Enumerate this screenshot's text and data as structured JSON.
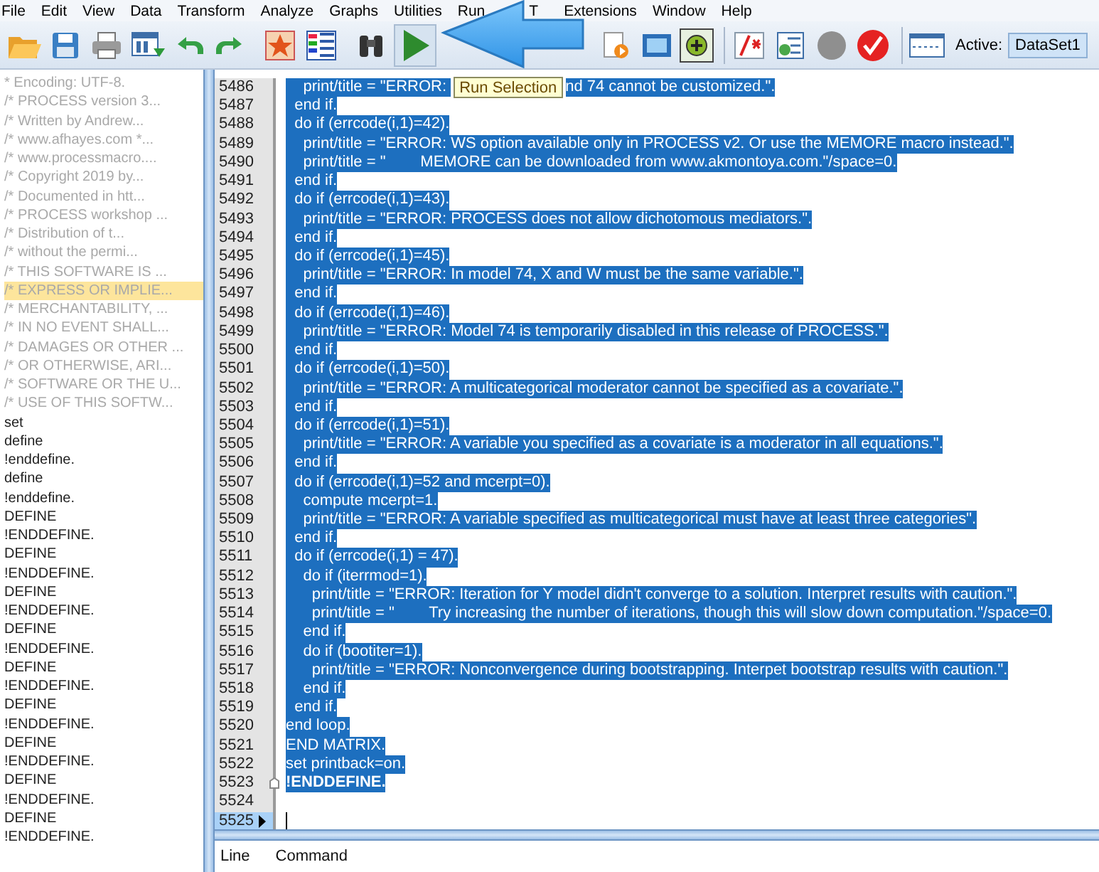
{
  "menu": [
    "File",
    "Edit",
    "View",
    "Data",
    "Transform",
    "Analyze",
    "Graphs",
    "Utilities",
    "Run",
    "T",
    "Extensions",
    "Window",
    "Help"
  ],
  "toolbar": {
    "active_label": "Active:",
    "dataset": "DataSet1"
  },
  "tooltip": "Run Selection",
  "navigator": [
    {
      "text": "* Encoding: UTF-8.",
      "kind": "comment",
      "selected": false
    },
    {
      "text": "/* PROCESS version 3...",
      "kind": "comment",
      "selected": false
    },
    {
      "text": "/* Written by Andrew...",
      "kind": "comment",
      "selected": false
    },
    {
      "text": "/* www.afhayes.com *...",
      "kind": "comment",
      "selected": false
    },
    {
      "text": "/* www.processmacro....",
      "kind": "comment",
      "selected": false
    },
    {
      "text": "/* Copyright 2019 by...",
      "kind": "comment",
      "selected": false
    },
    {
      "text": "/* Documented in htt...",
      "kind": "comment",
      "selected": false
    },
    {
      "text": "/* PROCESS workshop ...",
      "kind": "comment",
      "selected": false
    },
    {
      "text": "/* Distribution of t...",
      "kind": "comment",
      "selected": false
    },
    {
      "text": "/* without the permi...",
      "kind": "comment",
      "selected": false
    },
    {
      "text": "/* THIS SOFTWARE IS ...",
      "kind": "comment",
      "selected": false
    },
    {
      "text": "/* EXPRESS OR IMPLIE...",
      "kind": "comment",
      "selected": true
    },
    {
      "text": "/* MERCHANTABILITY, ...",
      "kind": "comment",
      "selected": false
    },
    {
      "text": "/* IN NO EVENT SHALL...",
      "kind": "comment",
      "selected": false
    },
    {
      "text": "/* DAMAGES OR OTHER ...",
      "kind": "comment",
      "selected": false
    },
    {
      "text": "/* OR OTHERWISE, ARI...",
      "kind": "comment",
      "selected": false
    },
    {
      "text": "/* SOFTWARE OR THE U...",
      "kind": "comment",
      "selected": false
    },
    {
      "text": "/* USE OF THIS SOFTW...",
      "kind": "comment",
      "selected": false
    },
    {
      "text": "set",
      "kind": "command",
      "selected": false
    },
    {
      "text": "define",
      "kind": "command",
      "selected": false
    },
    {
      "text": "!enddefine.",
      "kind": "command",
      "selected": false
    },
    {
      "text": "define",
      "kind": "command",
      "selected": false
    },
    {
      "text": "!enddefine.",
      "kind": "command",
      "selected": false
    },
    {
      "text": "DEFINE",
      "kind": "command",
      "selected": false
    },
    {
      "text": "!ENDDEFINE.",
      "kind": "command",
      "selected": false
    },
    {
      "text": "DEFINE",
      "kind": "command",
      "selected": false
    },
    {
      "text": "!ENDDEFINE.",
      "kind": "command",
      "selected": false
    },
    {
      "text": "DEFINE",
      "kind": "command",
      "selected": false
    },
    {
      "text": "!ENDDEFINE.",
      "kind": "command",
      "selected": false
    },
    {
      "text": "DEFINE",
      "kind": "command",
      "selected": false
    },
    {
      "text": "!ENDDEFINE.",
      "kind": "command",
      "selected": false
    },
    {
      "text": "DEFINE",
      "kind": "command",
      "selected": false
    },
    {
      "text": "!ENDDEFINE.",
      "kind": "command",
      "selected": false
    },
    {
      "text": "DEFINE",
      "kind": "command",
      "selected": false
    },
    {
      "text": "!ENDDEFINE.",
      "kind": "command",
      "selected": false
    },
    {
      "text": "DEFINE",
      "kind": "command",
      "selected": false
    },
    {
      "text": "!ENDDEFINE.",
      "kind": "command",
      "selected": false
    },
    {
      "text": "DEFINE",
      "kind": "command",
      "selected": false
    },
    {
      "text": "!ENDDEFINE.",
      "kind": "command",
      "selected": false
    },
    {
      "text": "DEFINE",
      "kind": "command",
      "selected": false
    },
    {
      "text": "!ENDDEFINE.",
      "kind": "command",
      "selected": false
    }
  ],
  "editor": {
    "lines": [
      {
        "number": "5486",
        "text": "    print/title = \"ERROR: ",
        "text_after": "nd 74 cannot be customized.\".",
        "selected": true,
        "current": false
      },
      {
        "number": "5487",
        "text": "  end if.",
        "selected": true,
        "current": false
      },
      {
        "number": "5488",
        "text": "  do if (errcode(i,1)=42).",
        "selected": true,
        "current": false
      },
      {
        "number": "5489",
        "text": "    print/title = \"ERROR: WS option available only in PROCESS v2. Or use the MEMORE macro instead.\".",
        "selected": true,
        "current": false
      },
      {
        "number": "5490",
        "text": "    print/title = \"        MEMORE can be downloaded from www.akmontoya.com.\"/space=0.",
        "selected": true,
        "current": false
      },
      {
        "number": "5491",
        "text": "  end if.",
        "selected": true,
        "current": false
      },
      {
        "number": "5492",
        "text": "  do if (errcode(i,1)=43).",
        "selected": true,
        "current": false
      },
      {
        "number": "5493",
        "text": "    print/title = \"ERROR: PROCESS does not allow dichotomous mediators.\".",
        "selected": true,
        "current": false
      },
      {
        "number": "5494",
        "text": "  end if.",
        "selected": true,
        "current": false
      },
      {
        "number": "5495",
        "text": "  do if (errcode(i,1)=45).",
        "selected": true,
        "current": false
      },
      {
        "number": "5496",
        "text": "    print/title = \"ERROR: In model 74, X and W must be the same variable.\".",
        "selected": true,
        "current": false
      },
      {
        "number": "5497",
        "text": "  end if.",
        "selected": true,
        "current": false
      },
      {
        "number": "5498",
        "text": "  do if (errcode(i,1)=46).",
        "selected": true,
        "current": false
      },
      {
        "number": "5499",
        "text": "    print/title = \"ERROR: Model 74 is temporarily disabled in this release of PROCESS.\".",
        "selected": true,
        "current": false
      },
      {
        "number": "5500",
        "text": "  end if.",
        "selected": true,
        "current": false
      },
      {
        "number": "5501",
        "text": "  do if (errcode(i,1)=50).",
        "selected": true,
        "current": false
      },
      {
        "number": "5502",
        "text": "    print/title = \"ERROR: A multicategorical moderator cannot be specified as a covariate.\".",
        "selected": true,
        "current": false
      },
      {
        "number": "5503",
        "text": "  end if.",
        "selected": true,
        "current": false
      },
      {
        "number": "5504",
        "text": "  do if (errcode(i,1)=51).",
        "selected": true,
        "current": false
      },
      {
        "number": "5505",
        "text": "    print/title = \"ERROR: A variable you specified as a covariate is a moderator in all equations.\".",
        "selected": true,
        "current": false
      },
      {
        "number": "5506",
        "text": "  end if.",
        "selected": true,
        "current": false
      },
      {
        "number": "5507",
        "text": "  do if (errcode(i,1)=52 and mcerpt=0).",
        "selected": true,
        "current": false
      },
      {
        "number": "5508",
        "text": "    compute mcerpt=1.",
        "selected": true,
        "current": false
      },
      {
        "number": "5509",
        "text": "    print/title = \"ERROR: A variable specified as multicategorical must have at least three categories\".",
        "selected": true,
        "current": false
      },
      {
        "number": "5510",
        "text": "  end if.",
        "selected": true,
        "current": false
      },
      {
        "number": "5511",
        "text": "  do if (errcode(i,1) = 47).",
        "selected": true,
        "current": false
      },
      {
        "number": "5512",
        "text": "    do if (iterrmod=1).",
        "selected": true,
        "current": false
      },
      {
        "number": "5513",
        "text": "      print/title = \"ERROR: Iteration for Y model didn't converge to a solution. Interpret results with caution.\".",
        "selected": true,
        "current": false
      },
      {
        "number": "5514",
        "text": "      print/title = \"        Try increasing the number of iterations, though this will slow down computation.\"/space=0.",
        "selected": true,
        "current": false
      },
      {
        "number": "5515",
        "text": "    end if.",
        "selected": true,
        "current": false
      },
      {
        "number": "5516",
        "text": "    do if (bootiter=1).",
        "selected": true,
        "current": false
      },
      {
        "number": "5517",
        "text": "      print/title = \"ERROR: Nonconvergence during bootstrapping. Interpet bootstrap results with caution.\".",
        "selected": true,
        "current": false
      },
      {
        "number": "5518",
        "text": "    end if.",
        "selected": true,
        "current": false
      },
      {
        "number": "5519",
        "text": "  end if.",
        "selected": true,
        "current": false
      },
      {
        "number": "5520",
        "text": "end loop.",
        "selected": true,
        "current": false
      },
      {
        "number": "5521",
        "text": "END MATRIX.",
        "selected": true,
        "current": false
      },
      {
        "number": "5522",
        "text": "set printback=on.",
        "selected": true,
        "current": false
      },
      {
        "number": "5523",
        "text": "!ENDDEFINE.",
        "selected": true,
        "current": false,
        "bold": true
      },
      {
        "number": "5524",
        "selected": false,
        "current": false
      },
      {
        "number": "5525",
        "selected": false,
        "current": true
      }
    ]
  },
  "error_pane": {
    "columns": [
      "Line",
      "Command"
    ]
  }
}
